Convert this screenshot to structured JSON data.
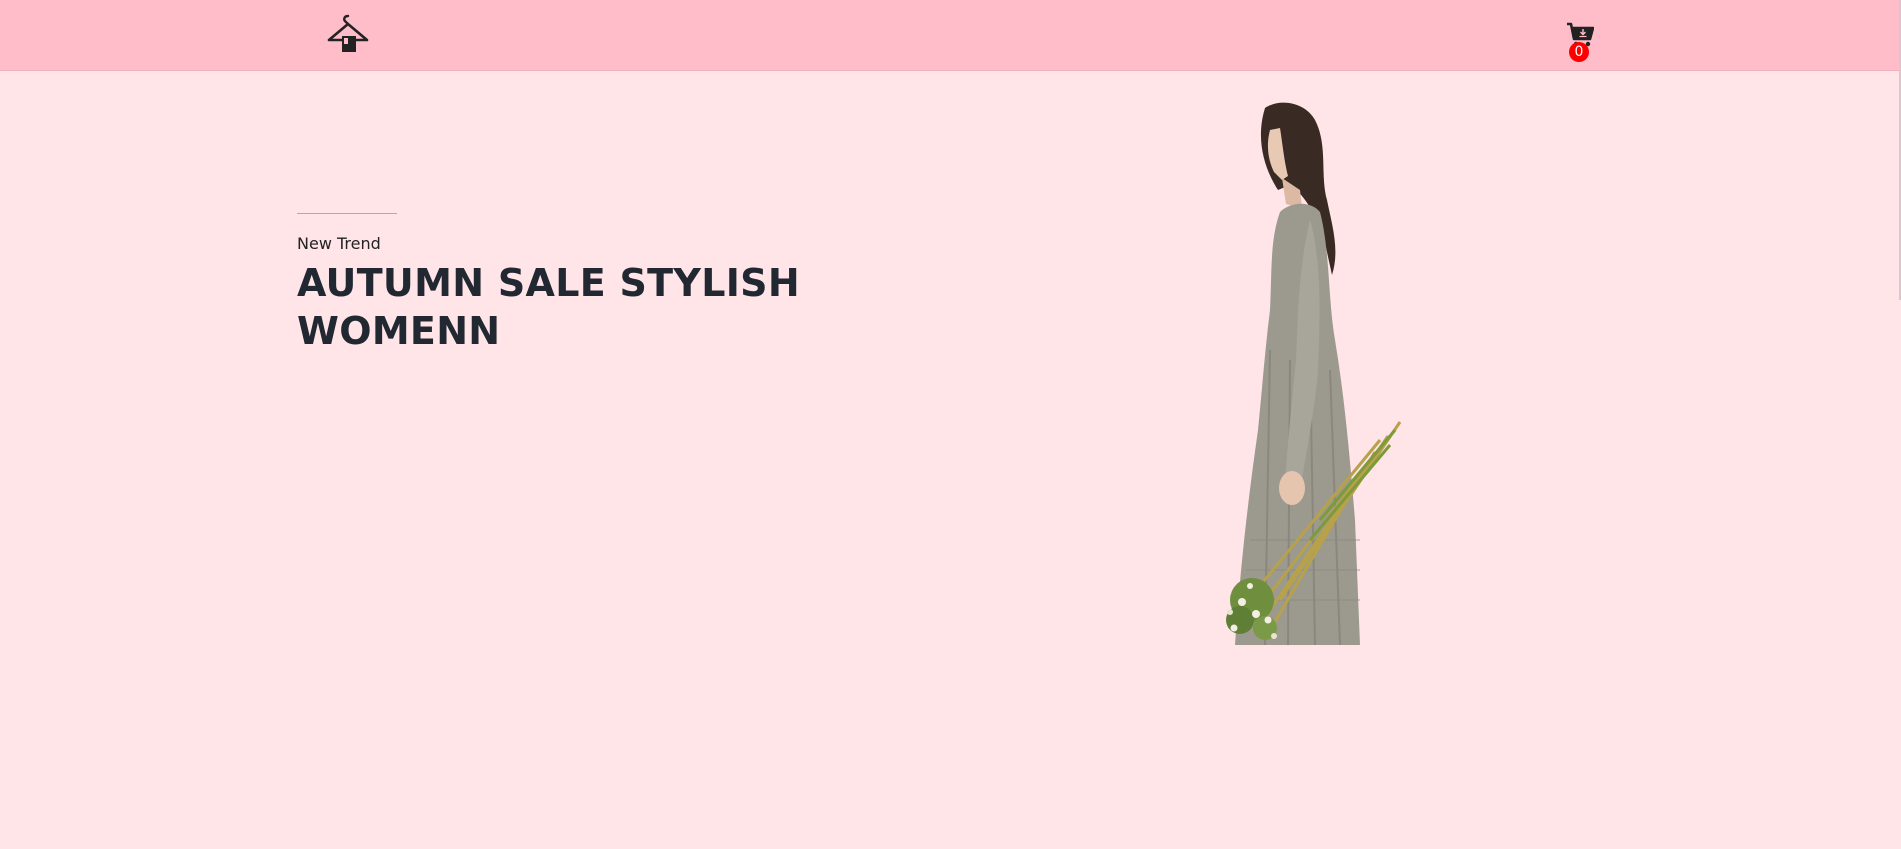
{
  "navbar": {
    "logo_icon": "hanger-logo-icon",
    "cart_icon": "cart-download-icon",
    "cart_count": "0",
    "colors": {
      "background": "#ffbcc9",
      "badge": "#ff0000"
    }
  },
  "hero": {
    "eyebrow": "New Trend",
    "title": "AUTUMN SALE STYLISH WOMENN",
    "image": "woman-in-grey-dress-holding-flower-bouquet",
    "background": "#ffe4e8"
  }
}
